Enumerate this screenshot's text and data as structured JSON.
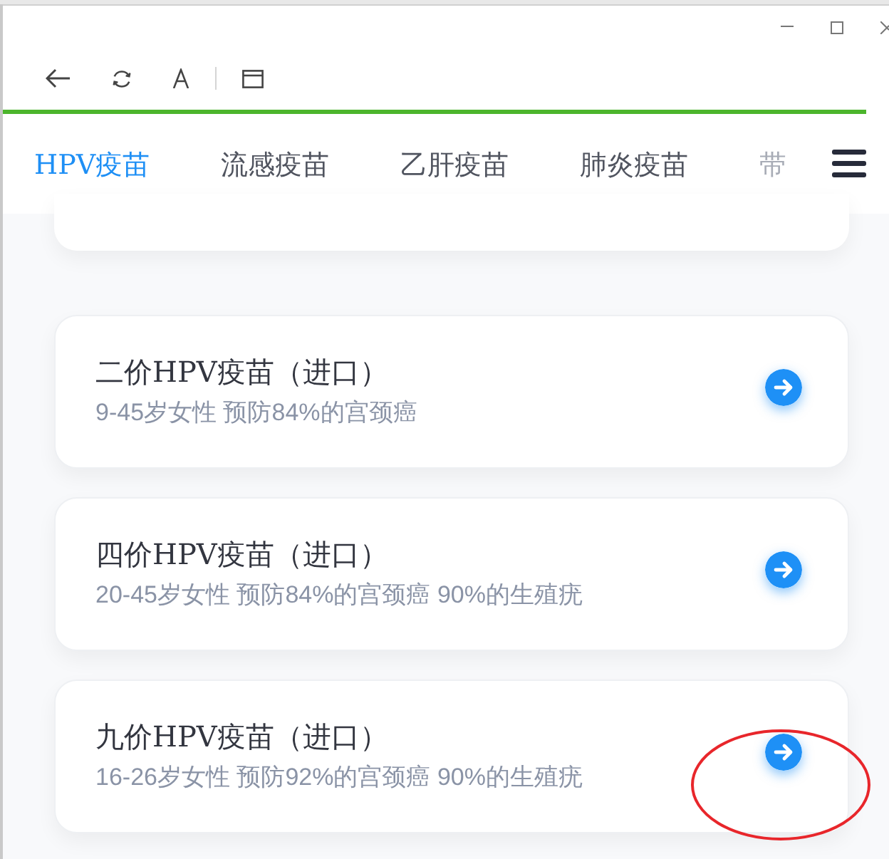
{
  "page_load": {
    "level": 0.975
  },
  "tabs": [
    {
      "label": "HPV疫苗",
      "selected": true
    },
    {
      "label": "流感疫苗",
      "selected": false
    },
    {
      "label": "乙肝疫苗",
      "selected": false
    },
    {
      "label": "肺炎疫苗",
      "selected": false
    },
    {
      "label": "带",
      "selected": false
    }
  ],
  "vaccines": [
    {
      "title": "二价HPV疫苗（进口）",
      "description": "9-45岁女性 预防84%的宫颈癌",
      "circled": false
    },
    {
      "title": "四价HPV疫苗（进口）",
      "description": "20-45岁女性 预防84%的宫颈癌 90%的生殖疣",
      "circled": false
    },
    {
      "title": "九价HPV疫苗（进口）",
      "description": "16-26岁女性 预防92%的宫颈癌 90%的生殖疣",
      "circled": true
    }
  ]
}
